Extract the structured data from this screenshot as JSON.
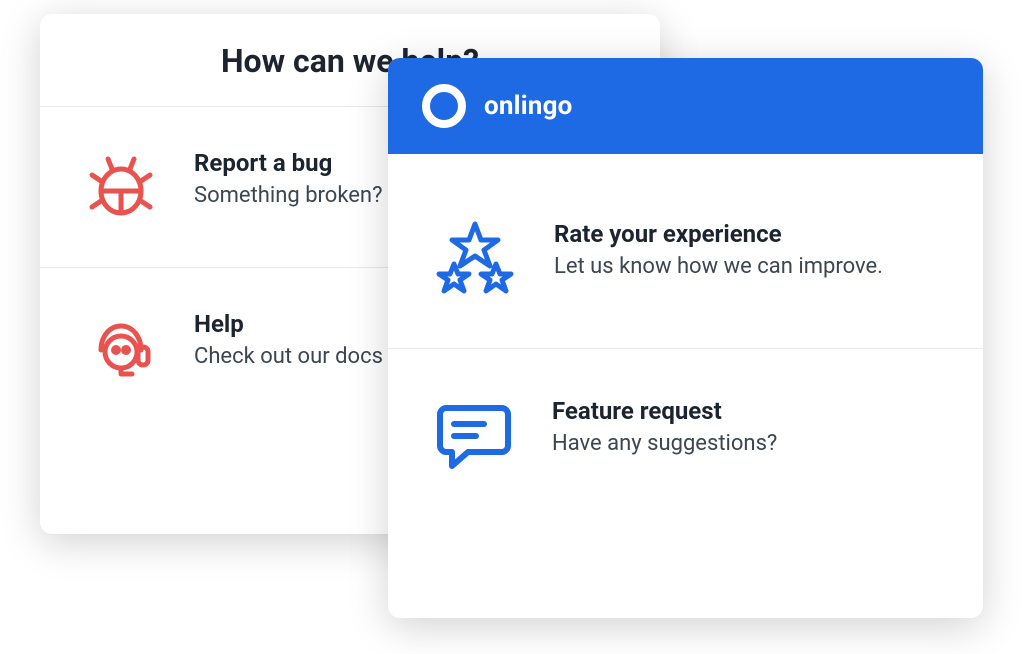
{
  "back_panel": {
    "title": "How can we help?",
    "options": [
      {
        "title": "Report a bug",
        "desc": "Something broken? Let us know!"
      },
      {
        "title": "Help",
        "desc": "Check out our docs or request support."
      }
    ]
  },
  "front_panel": {
    "brand": "onlingo",
    "options": [
      {
        "title": "Rate your experience",
        "desc": "Let us know how we can improve."
      },
      {
        "title": "Feature request",
        "desc": "Have any suggestions?"
      }
    ]
  },
  "colors": {
    "accent_red": "#e9534f",
    "accent_blue": "#1e6ae5"
  }
}
